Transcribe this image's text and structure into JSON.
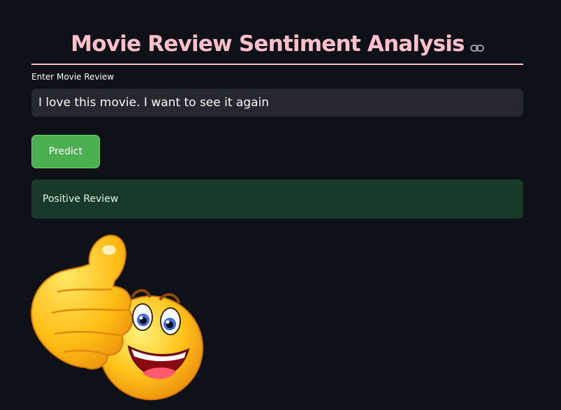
{
  "header": {
    "title": "Movie Review Sentiment Analysis",
    "anchor_icon": "link-icon"
  },
  "form": {
    "input_label": "Enter Movie Review",
    "input_value": "I love this movie. I want to see it again",
    "predict_label": "Predict"
  },
  "result": {
    "text": "Positive Review"
  },
  "image": {
    "icon": "thumbs-up-smiley-icon"
  },
  "colors": {
    "background": "#0e1117",
    "title": "#ffc0cb",
    "button": "#4caf50",
    "result_background": "#1a3a29"
  }
}
